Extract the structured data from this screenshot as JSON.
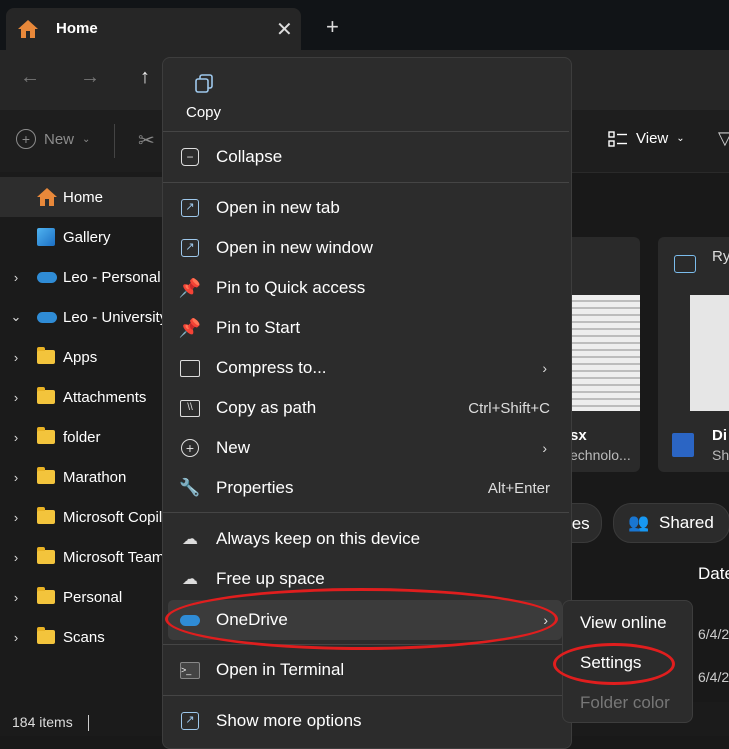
{
  "tab": {
    "title": "Home",
    "close": "✕",
    "new_tab": "+"
  },
  "toolbar": {
    "new_label": "New",
    "view_label": "View"
  },
  "sidebar": {
    "items": [
      {
        "label": "Home"
      },
      {
        "label": "Gallery"
      },
      {
        "label": "Leo - Personal"
      },
      {
        "label": "Leo - University"
      },
      {
        "label": "Apps"
      },
      {
        "label": "Attachments"
      },
      {
        "label": "folder"
      },
      {
        "label": "Marathon"
      },
      {
        "label": "Microsoft Copilot"
      },
      {
        "label": "Microsoft Teams"
      },
      {
        "label": "Personal"
      },
      {
        "label": "Scans"
      }
    ]
  },
  "status": {
    "items": "184 items"
  },
  "content": {
    "card1_title": "sx",
    "card1_sub": "echnolo...",
    "card2_top": "Ry",
    "card2_title": "Di",
    "card2_sub": "Sh",
    "filter_prev": "tes",
    "filter_shared": "Shared",
    "col_date": "Date",
    "row1_date": "6/4/2",
    "row2_date": "6/4/2"
  },
  "menu": {
    "copy": "Copy",
    "collapse": "Collapse",
    "open_new_tab": "Open in new tab",
    "open_new_window": "Open in new window",
    "pin_quick": "Pin to Quick access",
    "pin_start": "Pin to Start",
    "compress": "Compress to...",
    "copy_path": "Copy as path",
    "copy_path_shortcut": "Ctrl+Shift+C",
    "new": "New",
    "properties": "Properties",
    "properties_shortcut": "Alt+Enter",
    "always_keep": "Always keep on this device",
    "free_up": "Free up space",
    "onedrive": "OneDrive",
    "open_terminal": "Open in Terminal",
    "show_more": "Show more options"
  },
  "submenu": {
    "view_online": "View online",
    "settings": "Settings",
    "folder_color": "Folder color"
  },
  "colors": {
    "annotation": "#e01e1e",
    "folder": "#f3c43c",
    "onedrive": "#2f8cd6"
  }
}
